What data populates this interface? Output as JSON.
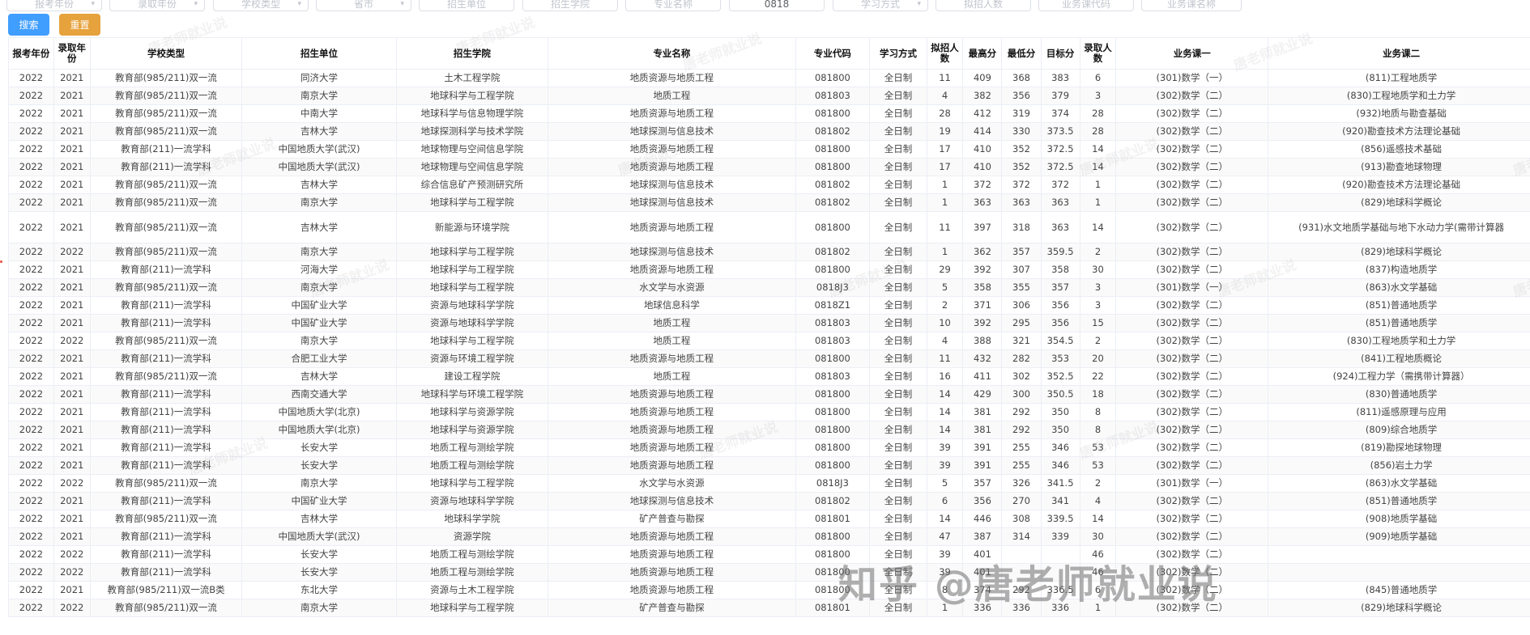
{
  "filters": [
    {
      "placeholder": "报考年份",
      "value": "",
      "has_arrow": true
    },
    {
      "placeholder": "录取年份",
      "value": "",
      "has_arrow": true
    },
    {
      "placeholder": "学校类型",
      "value": "",
      "has_arrow": true
    },
    {
      "placeholder": "省市",
      "value": "",
      "has_arrow": true
    },
    {
      "placeholder": "招生单位",
      "value": "",
      "has_arrow": false
    },
    {
      "placeholder": "招生学院",
      "value": "",
      "has_arrow": false
    },
    {
      "placeholder": "专业名称",
      "value": "",
      "has_arrow": false
    },
    {
      "placeholder": "",
      "value": "0818",
      "has_arrow": false
    },
    {
      "placeholder": "学习方式",
      "value": "",
      "has_arrow": true
    },
    {
      "placeholder": "拟招人数",
      "value": "",
      "has_arrow": false
    },
    {
      "placeholder": "业务课代码",
      "value": "",
      "has_arrow": false
    },
    {
      "placeholder": "业务课名称",
      "value": "",
      "has_arrow": false
    }
  ],
  "buttons": {
    "search": "搜索",
    "reset": "重置"
  },
  "table": {
    "columns": [
      "报考年份",
      "录取年份",
      "学校类型",
      "招生单位",
      "招生学院",
      "专业名称",
      "专业代码",
      "学习方式",
      "拟招人数",
      "最高分",
      "最低分",
      "目标分",
      "录取人数",
      "业务课一",
      "业务课二"
    ],
    "rows": [
      [
        "2022",
        "2021",
        "教育部(985/211)双一流",
        "同济大学",
        "土木工程学院",
        "地质资源与地质工程",
        "081800",
        "全日制",
        "11",
        "409",
        "368",
        "383",
        "6",
        "(301)数学（一）",
        "(811)工程地质学"
      ],
      [
        "2022",
        "2021",
        "教育部(985/211)双一流",
        "南京大学",
        "地球科学与工程学院",
        "地质工程",
        "081803",
        "全日制",
        "4",
        "382",
        "356",
        "379",
        "3",
        "(302)数学（二）",
        "(830)工程地质学和土力学"
      ],
      [
        "2022",
        "2021",
        "教育部(985/211)双一流",
        "中南大学",
        "地球科学与信息物理学院",
        "地质资源与地质工程",
        "081800",
        "全日制",
        "28",
        "412",
        "319",
        "374",
        "28",
        "(302)数学（二）",
        "(932)地质与勘查基础"
      ],
      [
        "2022",
        "2021",
        "教育部(985/211)双一流",
        "吉林大学",
        "地球探测科学与技术学院",
        "地球探测与信息技术",
        "081802",
        "全日制",
        "19",
        "414",
        "330",
        "373.5",
        "28",
        "(302)数学（二）",
        "(920)勘查技术方法理论基础"
      ],
      [
        "2022",
        "2021",
        "教育部(211)一流学科",
        "中国地质大学(武汉)",
        "地球物理与空间信息学院",
        "地质资源与地质工程",
        "081800",
        "全日制",
        "17",
        "410",
        "352",
        "372.5",
        "14",
        "(302)数学（二）",
        "(856)遥感技术基础"
      ],
      [
        "2022",
        "2021",
        "教育部(211)一流学科",
        "中国地质大学(武汉)",
        "地球物理与空间信息学院",
        "地质资源与地质工程",
        "081800",
        "全日制",
        "17",
        "410",
        "352",
        "372.5",
        "14",
        "(302)数学（二）",
        "(913)勘查地球物理"
      ],
      [
        "2022",
        "2021",
        "教育部(985/211)双一流",
        "吉林大学",
        "综合信息矿产预测研究所",
        "地球探测与信息技术",
        "081802",
        "全日制",
        "1",
        "372",
        "372",
        "372",
        "1",
        "(302)数学（二）",
        "(920)勘查技术方法理论基础"
      ],
      [
        "2022",
        "2021",
        "教育部(985/211)双一流",
        "南京大学",
        "地球科学与工程学院",
        "地球探测与信息技术",
        "081802",
        "全日制",
        "1",
        "363",
        "363",
        "363",
        "1",
        "(302)数学（二）",
        "(829)地球科学概论"
      ],
      [
        "2022",
        "2021",
        "教育部(985/211)双一流",
        "吉林大学",
        "新能源与环境学院",
        "地质资源与地质工程",
        "081800",
        "全日制",
        "11",
        "397",
        "318",
        "363",
        "14",
        "(302)数学（二）",
        "(931)水文地质学基础与地下水动力学(需带计算器"
      ],
      [
        "2022",
        "2022",
        "教育部(985/211)双一流",
        "南京大学",
        "地球科学与工程学院",
        "地球探测与信息技术",
        "081802",
        "全日制",
        "1",
        "362",
        "357",
        "359.5",
        "2",
        "(302)数学（二）",
        "(829)地球科学概论"
      ],
      [
        "2022",
        "2021",
        "教育部(211)一流学科",
        "河海大学",
        "地球科学与工程学院",
        "地质资源与地质工程",
        "081800",
        "全日制",
        "29",
        "392",
        "307",
        "358",
        "30",
        "(302)数学（二）",
        "(837)构造地质学"
      ],
      [
        "2022",
        "2021",
        "教育部(985/211)双一流",
        "南京大学",
        "地球科学与工程学院",
        "水文学与水资源",
        "0818J3",
        "全日制",
        "5",
        "358",
        "355",
        "357",
        "3",
        "(301)数学（一）",
        "(863)水文学基础"
      ],
      [
        "2022",
        "2021",
        "教育部(211)一流学科",
        "中国矿业大学",
        "资源与地球科学学院",
        "地球信息科学",
        "0818Z1",
        "全日制",
        "2",
        "371",
        "306",
        "356",
        "3",
        "(302)数学（二）",
        "(851)普通地质学"
      ],
      [
        "2022",
        "2021",
        "教育部(211)一流学科",
        "中国矿业大学",
        "资源与地球科学学院",
        "地质工程",
        "081803",
        "全日制",
        "10",
        "392",
        "295",
        "356",
        "15",
        "(302)数学（二）",
        "(851)普通地质学"
      ],
      [
        "2022",
        "2022",
        "教育部(985/211)双一流",
        "南京大学",
        "地球科学与工程学院",
        "地质工程",
        "081803",
        "全日制",
        "4",
        "388",
        "321",
        "354.5",
        "2",
        "(302)数学（二）",
        "(830)工程地质学和土力学"
      ],
      [
        "2022",
        "2021",
        "教育部(211)一流学科",
        "合肥工业大学",
        "资源与环境工程学院",
        "地质资源与地质工程",
        "081800",
        "全日制",
        "11",
        "432",
        "282",
        "353",
        "20",
        "(302)数学（二）",
        "(841)工程地质概论"
      ],
      [
        "2022",
        "2021",
        "教育部(985/211)双一流",
        "吉林大学",
        "建设工程学院",
        "地质工程",
        "081803",
        "全日制",
        "16",
        "411",
        "302",
        "352.5",
        "22",
        "(302)数学（二）",
        "(924)工程力学（需携带计算器）"
      ],
      [
        "2022",
        "2021",
        "教育部(211)一流学科",
        "西南交通大学",
        "地球科学与环境工程学院",
        "地质资源与地质工程",
        "081800",
        "全日制",
        "14",
        "429",
        "300",
        "350.5",
        "18",
        "(302)数学（二）",
        "(830)普通地质学"
      ],
      [
        "2022",
        "2021",
        "教育部(211)一流学科",
        "中国地质大学(北京)",
        "地球科学与资源学院",
        "地质资源与地质工程",
        "081800",
        "全日制",
        "14",
        "381",
        "292",
        "350",
        "8",
        "(302)数学（二）",
        "(811)遥感原理与应用"
      ],
      [
        "2022",
        "2021",
        "教育部(211)一流学科",
        "中国地质大学(北京)",
        "地球科学与资源学院",
        "地质资源与地质工程",
        "081800",
        "全日制",
        "14",
        "381",
        "292",
        "350",
        "8",
        "(302)数学（二）",
        "(809)综合地质学"
      ],
      [
        "2022",
        "2021",
        "教育部(211)一流学科",
        "长安大学",
        "地质工程与测绘学院",
        "地质资源与地质工程",
        "081800",
        "全日制",
        "39",
        "391",
        "255",
        "346",
        "53",
        "(302)数学（二）",
        "(819)勘探地球物理"
      ],
      [
        "2022",
        "2021",
        "教育部(211)一流学科",
        "长安大学",
        "地质工程与测绘学院",
        "地质资源与地质工程",
        "081800",
        "全日制",
        "39",
        "391",
        "255",
        "346",
        "53",
        "(302)数学（二）",
        "(856)岩土力学"
      ],
      [
        "2022",
        "2022",
        "教育部(985/211)双一流",
        "南京大学",
        "地球科学与工程学院",
        "水文学与水资源",
        "0818J3",
        "全日制",
        "5",
        "357",
        "326",
        "341.5",
        "2",
        "(301)数学（一）",
        "(863)水文学基础"
      ],
      [
        "2022",
        "2021",
        "教育部(211)一流学科",
        "中国矿业大学",
        "资源与地球科学学院",
        "地球探测与信息技术",
        "081802",
        "全日制",
        "6",
        "356",
        "270",
        "341",
        "4",
        "(302)数学（二）",
        "(851)普通地质学"
      ],
      [
        "2022",
        "2021",
        "教育部(985/211)双一流",
        "吉林大学",
        "地球科学学院",
        "矿产普查与勘探",
        "081801",
        "全日制",
        "14",
        "446",
        "308",
        "339.5",
        "14",
        "(302)数学（二）",
        "(908)地质学基础"
      ],
      [
        "2022",
        "2021",
        "教育部(211)一流学科",
        "中国地质大学(武汉)",
        "资源学院",
        "地质资源与地质工程",
        "081800",
        "全日制",
        "47",
        "387",
        "314",
        "339",
        "30",
        "(302)数学（二）",
        "(909)地质学基础"
      ],
      [
        "2022",
        "2022",
        "教育部(211)一流学科",
        "长安大学",
        "地质工程与测绘学院",
        "地质资源与地质工程",
        "081800",
        "全日制",
        "39",
        "401",
        "",
        "",
        "46",
        "(302)数学（二）",
        ""
      ],
      [
        "2022",
        "2022",
        "教育部(211)一流学科",
        "长安大学",
        "地质工程与测绘学院",
        "地质资源与地质工程",
        "081800",
        "全日制",
        "39",
        "401",
        "",
        "",
        "46",
        "(302)数学（二）",
        ""
      ],
      [
        "2022",
        "2021",
        "教育部(985/211)双一流B类",
        "东北大学",
        "资源与土木工程学院",
        "地质资源与地质工程",
        "081800",
        "全日制",
        "8",
        "374",
        "292",
        "336.5",
        "6",
        "(302)数学（二）",
        "(845)普通地质学"
      ],
      [
        "2022",
        "2022",
        "教育部(985/211)双一流",
        "南京大学",
        "地球科学与工程学院",
        "矿产普查与勘探",
        "081801",
        "全日制",
        "1",
        "336",
        "336",
        "336",
        "1",
        "(302)数学（二）",
        "(829)地球科学概论"
      ]
    ]
  },
  "watermark_text": "唐老师就业说",
  "brand_watermark": "知乎 @唐老师就业说"
}
